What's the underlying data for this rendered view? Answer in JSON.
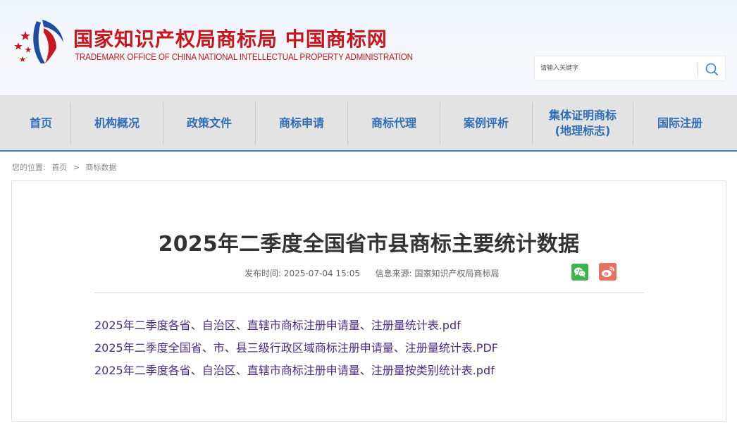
{
  "header": {
    "title": "国家知识产权局商标局 中国商标网",
    "subtitle": "TRADEMARK OFFICE OF CHINA NATIONAL INTELLECTUAL PROPERTY ADMINISTRATION",
    "emblem_icon": "cnipa-emblem-icon",
    "brand_red": "#c8161d",
    "brand_blue": "#1f4ea0"
  },
  "search": {
    "placeholder": "请输入关键字",
    "button_icon": "search-icon"
  },
  "nav": {
    "items": [
      {
        "label": "首页"
      },
      {
        "label": "机构概况"
      },
      {
        "label": "政策文件"
      },
      {
        "label": "商标申请"
      },
      {
        "label": "商标代理"
      },
      {
        "label": "案例评析"
      },
      {
        "label_line1": "集体证明商标",
        "label_line2": "(地理标志)"
      },
      {
        "label": "国际注册"
      }
    ],
    "color": "#2e6db4"
  },
  "breadcrumb": {
    "prefix": "您的位置:",
    "home": "首页",
    "separator": ">",
    "current": "商标数据"
  },
  "article": {
    "title": "2025年二季度全国省市县商标主要统计数据",
    "publish_label": "发布时间:",
    "publish_time": "2025-07-04 15:05",
    "source_label": "信息来源:",
    "source": "国家知识产权局商标局",
    "share_icons": [
      "wechat-icon",
      "weibo-icon"
    ],
    "files": [
      {
        "name": "2025年二季度各省、自治区、直辖市商标注册申请量、注册量统计表.pdf"
      },
      {
        "name": "2025年二季度全国省、市、县三级行政区域商标注册申请量、注册量统计表.PDF"
      },
      {
        "name": "2025年二季度各省、自治区、直辖市商标注册申请量、注册量按类别统计表.pdf"
      }
    ],
    "link_color": "#4b2c83"
  }
}
